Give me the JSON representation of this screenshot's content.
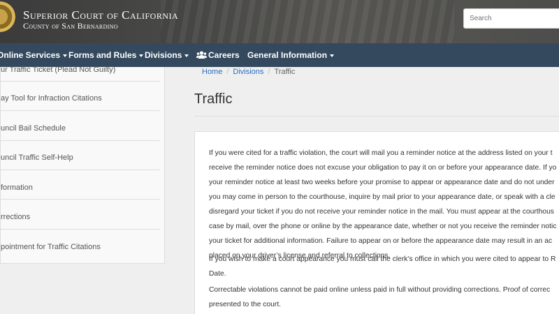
{
  "header": {
    "title": "Superior Court of California",
    "subtitle": "County of San Bernardino",
    "search_placeholder": "Search"
  },
  "nav": {
    "items": [
      {
        "label": "Online Services"
      },
      {
        "label": "Forms and Rules"
      },
      {
        "label": "Divisions"
      },
      {
        "label": "Careers",
        "icon": "users-icon"
      },
      {
        "label": "General Information"
      }
    ]
  },
  "sidebar": {
    "items": [
      {
        "label": "ur Traffic Ticket (Plead Not Guilty)"
      },
      {
        "label": "ay Tool for Infraction Citations"
      },
      {
        "label": "uncil Bail Schedule"
      },
      {
        "label": "uncil Traffic Self-Help"
      },
      {
        "label": "formation"
      },
      {
        "label": "rrections"
      },
      {
        "label": "pointment for Traffic Citations"
      }
    ]
  },
  "breadcrumb": {
    "home": "Home",
    "divisions": "Divisions",
    "current": "Traffic",
    "separator": "/"
  },
  "page": {
    "title": "Traffic"
  },
  "content": {
    "p1": [
      "If you were cited for a traffic violation, the court will mail you a reminder notice at the address listed on your t",
      "receive the reminder notice does not excuse your obligation to pay it on or before your appearance date. If yo",
      "your reminder notice at least two weeks before your promise to appear or appearance date and do not under",
      "you may come in person to the courthouse, inquire by mail prior to your appearance date, or speak with a cle",
      "disregard your ticket if you do not receive your reminder notice in the mail. You must appear at the courthous",
      "case by mail, over the phone or online by the appearance date, whether or not you receive the reminder notic",
      "your ticket for additional information. Failure to appear on or before the appearance date may result in an ac",
      "placed on your driver’s license and referral to collections."
    ],
    "p2": [
      "If you wish to make a court appearance you must call the clerk’s office in which you were cited to appear to R",
      "Date."
    ],
    "p3": [
      "Correctable violations cannot be paid online unless paid in full without providing corrections. Proof of correc",
      "presented to the court."
    ]
  },
  "colors": {
    "nav_bg": "#34495e",
    "link": "#2a6fbd",
    "header_bg": "#4a4a48"
  }
}
